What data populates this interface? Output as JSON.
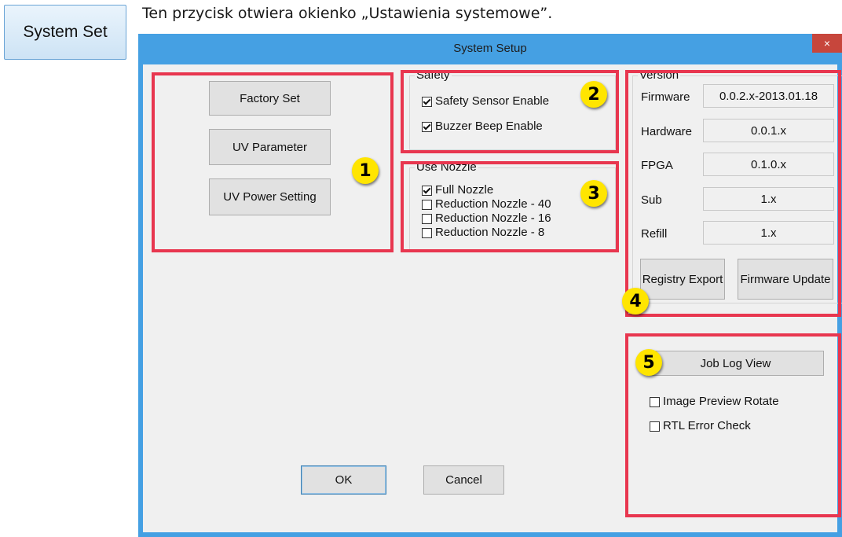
{
  "system_set_button": "System Set",
  "caption": "Ten przycisk otwiera okienko „Ustawienia systemowe”.",
  "dialog": {
    "title": "System Setup",
    "close_glyph": "×",
    "left_buttons": [
      "Factory Set",
      "UV Parameter",
      "UV Power Setting"
    ],
    "safety": {
      "title": "Safety",
      "options": [
        {
          "label": "Safety Sensor Enable",
          "checked": true
        },
        {
          "label": "Buzzer Beep Enable",
          "checked": true
        }
      ]
    },
    "nozzle": {
      "title": "Use Nozzle",
      "options": [
        {
          "label": "Full Nozzle",
          "checked": true
        },
        {
          "label": "Reduction Nozzle - 40",
          "checked": false
        },
        {
          "label": "Reduction Nozzle - 16",
          "checked": false
        },
        {
          "label": "Reduction Nozzle - 8",
          "checked": false
        }
      ]
    },
    "version": {
      "title": "Version",
      "rows": [
        {
          "label": "Firmware",
          "value": "0.0.2.x-2013.01.18"
        },
        {
          "label": "Hardware",
          "value": "0.0.1.x"
        },
        {
          "label": "FPGA",
          "value": "0.1.0.x"
        },
        {
          "label": "Sub",
          "value": "1.x"
        },
        {
          "label": "Refill",
          "value": "1.x"
        }
      ],
      "registry_export": "Registry Export",
      "firmware_update": "Firmware Update"
    },
    "job_log_view": "Job Log View",
    "extra_options": [
      {
        "label": "Image Preview Rotate",
        "checked": false
      },
      {
        "label": "RTL Error Check",
        "checked": false
      }
    ],
    "ok": "OK",
    "cancel": "Cancel"
  },
  "badges": [
    "1",
    "2",
    "3",
    "4",
    "5"
  ],
  "colors": {
    "annotation_red": "#e8364f",
    "badge_yellow": "#ffe500",
    "titlebar_blue": "#45a0e3",
    "close_red": "#c7463c"
  }
}
